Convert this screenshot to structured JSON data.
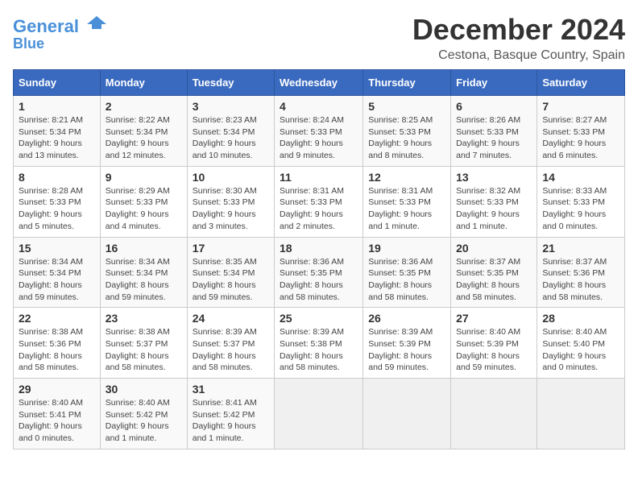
{
  "logo": {
    "line1": "General",
    "line2": "Blue"
  },
  "title": "December 2024",
  "subtitle": "Cestona, Basque Country, Spain",
  "days_of_week": [
    "Sunday",
    "Monday",
    "Tuesday",
    "Wednesday",
    "Thursday",
    "Friday",
    "Saturday"
  ],
  "weeks": [
    [
      {
        "day": "1",
        "info": "Sunrise: 8:21 AM\nSunset: 5:34 PM\nDaylight: 9 hours and 13 minutes."
      },
      {
        "day": "2",
        "info": "Sunrise: 8:22 AM\nSunset: 5:34 PM\nDaylight: 9 hours and 12 minutes."
      },
      {
        "day": "3",
        "info": "Sunrise: 8:23 AM\nSunset: 5:34 PM\nDaylight: 9 hours and 10 minutes."
      },
      {
        "day": "4",
        "info": "Sunrise: 8:24 AM\nSunset: 5:33 PM\nDaylight: 9 hours and 9 minutes."
      },
      {
        "day": "5",
        "info": "Sunrise: 8:25 AM\nSunset: 5:33 PM\nDaylight: 9 hours and 8 minutes."
      },
      {
        "day": "6",
        "info": "Sunrise: 8:26 AM\nSunset: 5:33 PM\nDaylight: 9 hours and 7 minutes."
      },
      {
        "day": "7",
        "info": "Sunrise: 8:27 AM\nSunset: 5:33 PM\nDaylight: 9 hours and 6 minutes."
      }
    ],
    [
      {
        "day": "8",
        "info": "Sunrise: 8:28 AM\nSunset: 5:33 PM\nDaylight: 9 hours and 5 minutes."
      },
      {
        "day": "9",
        "info": "Sunrise: 8:29 AM\nSunset: 5:33 PM\nDaylight: 9 hours and 4 minutes."
      },
      {
        "day": "10",
        "info": "Sunrise: 8:30 AM\nSunset: 5:33 PM\nDaylight: 9 hours and 3 minutes."
      },
      {
        "day": "11",
        "info": "Sunrise: 8:31 AM\nSunset: 5:33 PM\nDaylight: 9 hours and 2 minutes."
      },
      {
        "day": "12",
        "info": "Sunrise: 8:31 AM\nSunset: 5:33 PM\nDaylight: 9 hours and 1 minute."
      },
      {
        "day": "13",
        "info": "Sunrise: 8:32 AM\nSunset: 5:33 PM\nDaylight: 9 hours and 1 minute."
      },
      {
        "day": "14",
        "info": "Sunrise: 8:33 AM\nSunset: 5:33 PM\nDaylight: 9 hours and 0 minutes."
      }
    ],
    [
      {
        "day": "15",
        "info": "Sunrise: 8:34 AM\nSunset: 5:34 PM\nDaylight: 8 hours and 59 minutes."
      },
      {
        "day": "16",
        "info": "Sunrise: 8:34 AM\nSunset: 5:34 PM\nDaylight: 8 hours and 59 minutes."
      },
      {
        "day": "17",
        "info": "Sunrise: 8:35 AM\nSunset: 5:34 PM\nDaylight: 8 hours and 59 minutes."
      },
      {
        "day": "18",
        "info": "Sunrise: 8:36 AM\nSunset: 5:35 PM\nDaylight: 8 hours and 58 minutes."
      },
      {
        "day": "19",
        "info": "Sunrise: 8:36 AM\nSunset: 5:35 PM\nDaylight: 8 hours and 58 minutes."
      },
      {
        "day": "20",
        "info": "Sunrise: 8:37 AM\nSunset: 5:35 PM\nDaylight: 8 hours and 58 minutes."
      },
      {
        "day": "21",
        "info": "Sunrise: 8:37 AM\nSunset: 5:36 PM\nDaylight: 8 hours and 58 minutes."
      }
    ],
    [
      {
        "day": "22",
        "info": "Sunrise: 8:38 AM\nSunset: 5:36 PM\nDaylight: 8 hours and 58 minutes."
      },
      {
        "day": "23",
        "info": "Sunrise: 8:38 AM\nSunset: 5:37 PM\nDaylight: 8 hours and 58 minutes."
      },
      {
        "day": "24",
        "info": "Sunrise: 8:39 AM\nSunset: 5:37 PM\nDaylight: 8 hours and 58 minutes."
      },
      {
        "day": "25",
        "info": "Sunrise: 8:39 AM\nSunset: 5:38 PM\nDaylight: 8 hours and 58 minutes."
      },
      {
        "day": "26",
        "info": "Sunrise: 8:39 AM\nSunset: 5:39 PM\nDaylight: 8 hours and 59 minutes."
      },
      {
        "day": "27",
        "info": "Sunrise: 8:40 AM\nSunset: 5:39 PM\nDaylight: 8 hours and 59 minutes."
      },
      {
        "day": "28",
        "info": "Sunrise: 8:40 AM\nSunset: 5:40 PM\nDaylight: 9 hours and 0 minutes."
      }
    ],
    [
      {
        "day": "29",
        "info": "Sunrise: 8:40 AM\nSunset: 5:41 PM\nDaylight: 9 hours and 0 minutes."
      },
      {
        "day": "30",
        "info": "Sunrise: 8:40 AM\nSunset: 5:42 PM\nDaylight: 9 hours and 1 minute."
      },
      {
        "day": "31",
        "info": "Sunrise: 8:41 AM\nSunset: 5:42 PM\nDaylight: 9 hours and 1 minute."
      },
      {
        "day": "",
        "info": ""
      },
      {
        "day": "",
        "info": ""
      },
      {
        "day": "",
        "info": ""
      },
      {
        "day": "",
        "info": ""
      }
    ]
  ]
}
